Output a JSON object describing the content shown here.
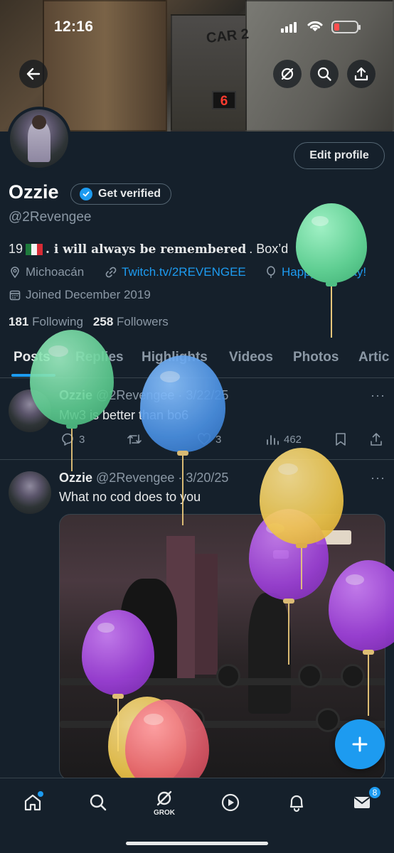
{
  "status_bar": {
    "time": "12:16"
  },
  "banner": {
    "car_label": "CAR 2",
    "floor_display": "6"
  },
  "profile": {
    "edit_button": "Edit profile",
    "display_name": "Ozzie",
    "get_verified": "Get verified",
    "handle": "@2Revengee",
    "bio": {
      "prefix": "19",
      "emphasis": ". i will always be remembered",
      "suffix": ". Box’d"
    },
    "location": "Michoacán",
    "website": "Twitch.tv/2REVENGEE",
    "birthday": "Happy birthday!",
    "joined": "Joined December 2019",
    "following_count": "181",
    "following_label": "Following",
    "followers_count": "258",
    "followers_label": "Followers"
  },
  "tabs": [
    "Posts",
    "Replies",
    "Highlights",
    "Videos",
    "Photos",
    "Artic"
  ],
  "posts": [
    {
      "name": "Ozzie",
      "meta": "@2Revengee · 3/22/25",
      "text": "Mw3 is better than bo6",
      "replies": "3",
      "likes": "3",
      "views": "462"
    },
    {
      "name": "Ozzie",
      "meta": "@2Revengee · 3/20/25",
      "text": "What no cod does to you"
    }
  ],
  "nav": {
    "grok_label": "GROK",
    "messages_badge": "8"
  },
  "colors": {
    "background": "#15202b",
    "accent": "#1d9bf0",
    "muted_text": "#8b98a5",
    "balloon_green": "#6fd8a0",
    "balloon_blue": "#4a90e2",
    "balloon_yellow": "#f2c94c",
    "balloon_purple": "#9b3fd6",
    "balloon_red": "#e25b6a"
  },
  "icons": [
    "back-arrow-icon",
    "grok-slash-icon",
    "search-icon",
    "share-icon",
    "location-pin-icon",
    "link-icon",
    "balloon-icon",
    "calendar-icon",
    "reply-icon",
    "retweet-icon",
    "like-icon",
    "views-icon",
    "bookmark-icon",
    "plus-icon",
    "home-icon",
    "grok-icon",
    "play-icon",
    "bell-icon",
    "mail-icon"
  ]
}
